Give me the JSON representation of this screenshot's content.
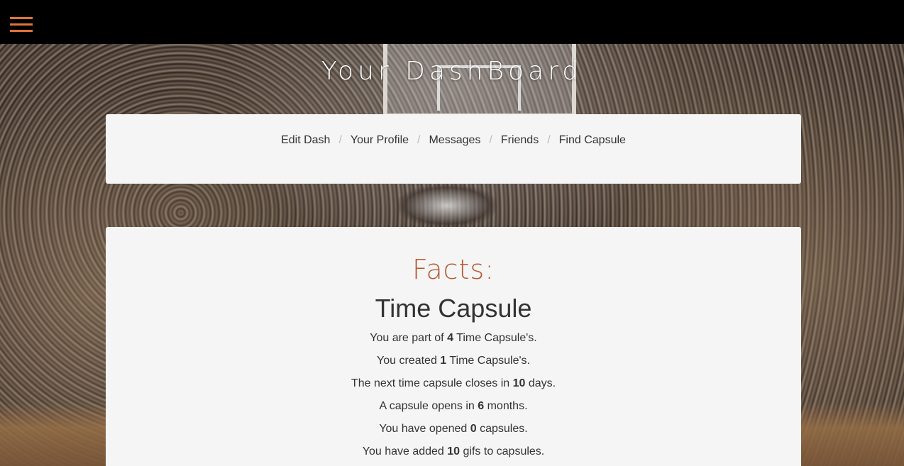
{
  "header": {
    "menu_icon": "hamburger-menu-icon",
    "accent_color": "#e0733a"
  },
  "page": {
    "title": "Your DashBoard"
  },
  "nav": {
    "items": [
      {
        "label": "Edit Dash"
      },
      {
        "label": "Your Profile"
      },
      {
        "label": "Messages"
      },
      {
        "label": "Friends"
      },
      {
        "label": "Find Capsule"
      }
    ],
    "separator": "/"
  },
  "facts": {
    "heading": "Facts:",
    "heading_color": "#b35a33",
    "section_title": "Time Capsule",
    "lines": [
      {
        "before": "You are part of ",
        "value": "4",
        "after": " Time Capsule's."
      },
      {
        "before": "You created ",
        "value": "1",
        "after": " Time Capsule's."
      },
      {
        "before": "The next time capsule closes in ",
        "value": "10",
        "after": " days."
      },
      {
        "before": "A capsule opens in ",
        "value": "6",
        "after": " months."
      },
      {
        "before": "You have opened ",
        "value": "0",
        "after": " capsules."
      },
      {
        "before": "You have added ",
        "value": "10",
        "after": " gifs to capsules."
      }
    ]
  }
}
